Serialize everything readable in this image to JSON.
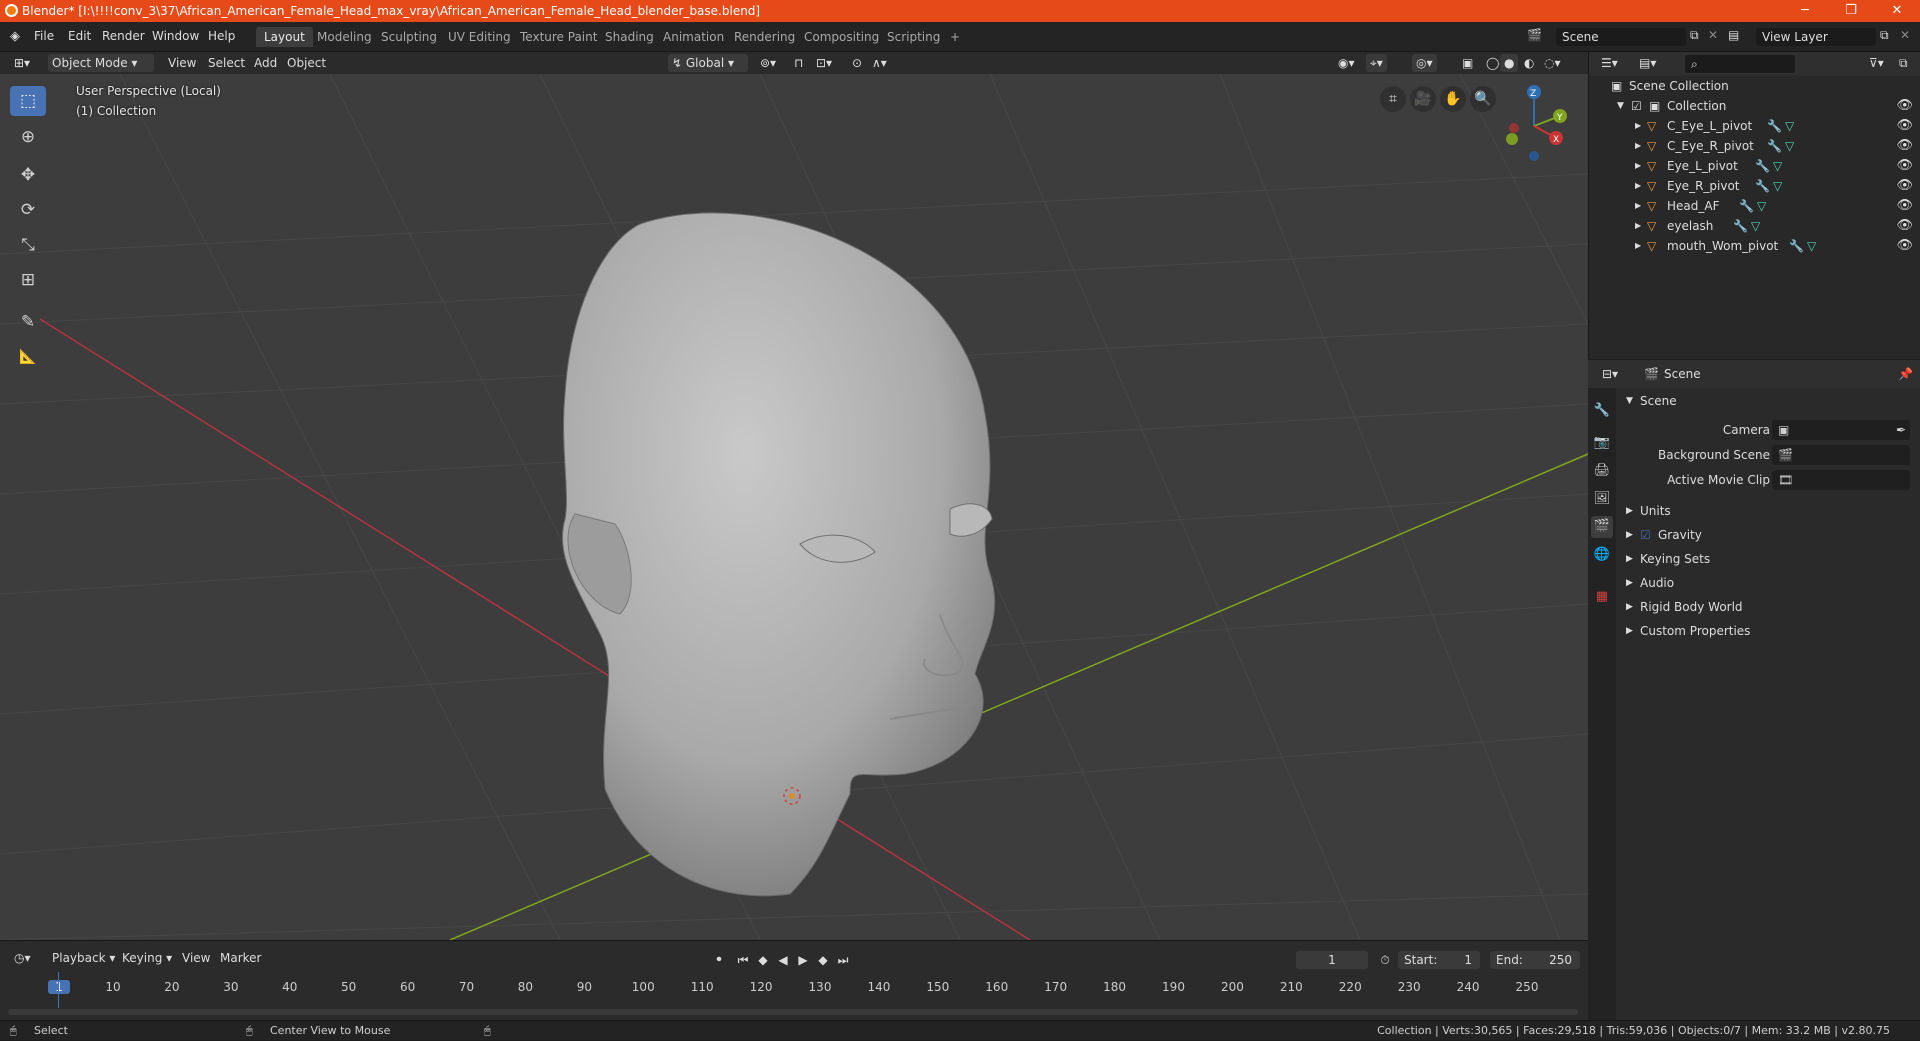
{
  "window": {
    "title": "Blender* [I:\\!!!!conv_3\\37\\African_American_Female_Head_max_vray\\African_American_Female_Head_blender_base.blend]",
    "buttons": [
      "─",
      "❐",
      "✕"
    ]
  },
  "menus": [
    "File",
    "Edit",
    "Render",
    "Window",
    "Help"
  ],
  "workspaces": [
    {
      "label": "Layout",
      "active": true
    },
    {
      "label": "Modeling"
    },
    {
      "label": "Sculpting"
    },
    {
      "label": "UV Editing"
    },
    {
      "label": "Texture Paint"
    },
    {
      "label": "Shading"
    },
    {
      "label": "Animation"
    },
    {
      "label": "Rendering"
    },
    {
      "label": "Compositing"
    },
    {
      "label": "Scripting"
    }
  ],
  "add_workspace_label": "+",
  "scene_field": "Scene",
  "view_layer_field": "View Layer",
  "header3d": {
    "mode": "Object Mode",
    "menus": [
      "View",
      "Select",
      "Add",
      "Object"
    ],
    "transform_orientation": "Global"
  },
  "viewport": {
    "perspective_label": "User Perspective (Local)",
    "collection_label": "(1) Collection",
    "colors": {
      "x_axis": "#b3343f",
      "y_axis": "#7fa51f",
      "background": "#3d3d3d"
    },
    "gizmo": {
      "z": "Z",
      "y": "Y",
      "x": "X"
    }
  },
  "tools": [
    {
      "name": "select-box-tool",
      "glyph": "⬚",
      "active": true
    },
    {
      "name": "cursor-tool",
      "glyph": "⊕"
    },
    {
      "name": "move-tool",
      "glyph": "✥"
    },
    {
      "name": "rotate-tool",
      "glyph": "⟳"
    },
    {
      "name": "scale-tool",
      "glyph": "⤡"
    },
    {
      "name": "transform-tool",
      "glyph": "⊞"
    },
    {
      "name": "annotate-tool",
      "glyph": "✎"
    },
    {
      "name": "measure-tool",
      "glyph": "📐"
    }
  ],
  "outliner": {
    "root": "Scene Collection",
    "collection": "Collection",
    "items": [
      "C_Eye_L_pivot",
      "C_Eye_R_pivot",
      "Eye_L_pivot",
      "Eye_R_pivot",
      "Head_AF",
      "eyelash",
      "mouth_Wom_pivot"
    ]
  },
  "properties": {
    "context": "Scene",
    "panel": "Scene",
    "fields": [
      {
        "label": "Camera"
      },
      {
        "label": "Background Scene"
      },
      {
        "label": "Active Movie Clip"
      }
    ],
    "subpanels": [
      "Units",
      "Gravity",
      "Keying Sets",
      "Audio",
      "Rigid Body World",
      "Custom Properties"
    ]
  },
  "timeline": {
    "menus": [
      "Playback",
      "Keying",
      "View",
      "Marker"
    ],
    "current_frame": "1",
    "start_label": "Start:",
    "start": "1",
    "end_label": "End:",
    "end": "250",
    "ticks": [
      "1",
      "10",
      "20",
      "30",
      "40",
      "50",
      "60",
      "70",
      "80",
      "90",
      "100",
      "110",
      "120",
      "130",
      "140",
      "150",
      "160",
      "170",
      "180",
      "190",
      "200",
      "210",
      "220",
      "230",
      "240",
      "250"
    ]
  },
  "status": {
    "left": "Select",
    "middle": "Center View to Mouse",
    "right": "Collection | Verts:30,565 | Faces:29,518 | Tris:59,036 | Objects:0/7 | Mem: 33.2 MB | v2.80.75"
  }
}
